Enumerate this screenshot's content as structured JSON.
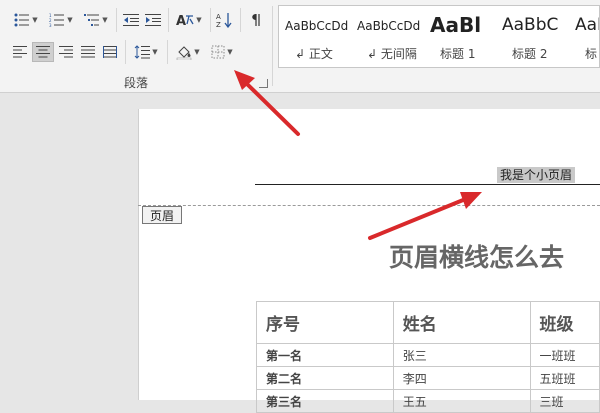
{
  "paragraph_group": {
    "label": "段落"
  },
  "styles": [
    {
      "sample": "AaBbCcDd",
      "name": "↲ 正文"
    },
    {
      "sample": "AaBbCcDd",
      "name": "↲ 无间隔"
    },
    {
      "sample": "AaBl",
      "name": "标题 1"
    },
    {
      "sample": "AaBbC",
      "name": "标题 2"
    },
    {
      "sample": "AaBb",
      "name": "标"
    }
  ],
  "icons": {
    "bullets": "bullets-icon",
    "numbering": "numbering-icon",
    "multilevel": "multilevel-list-icon",
    "decrease_indent": "decrease-indent-icon",
    "increase_indent": "increase-indent-icon",
    "chinese_layout": "chinese-layout-icon",
    "sort": "sort-icon",
    "show_marks": "show-marks-icon",
    "align_left": "align-left-icon",
    "align_center": "align-center-icon",
    "align_right": "align-right-icon",
    "justify": "justify-icon",
    "distributed": "distributed-icon",
    "line_spacing": "line-spacing-icon",
    "shading": "shading-icon",
    "borders": "borders-icon"
  },
  "document": {
    "header_text": "我是个小页眉",
    "header_tag": "页眉",
    "title": "页眉横线怎么去",
    "table": {
      "headers": [
        "序号",
        "姓名",
        "班级"
      ],
      "rows": [
        [
          "第一名",
          "张三",
          "一班班"
        ],
        [
          "第二名",
          "李四",
          "五班班"
        ],
        [
          "第三名",
          "王五",
          "三班"
        ]
      ]
    }
  },
  "colors": {
    "annotation_arrow": "#d9292b",
    "selection": "#c9c9c9"
  }
}
